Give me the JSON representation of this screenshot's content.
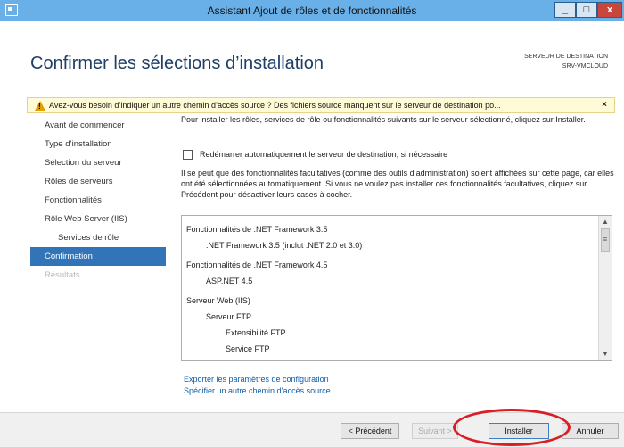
{
  "window": {
    "title": "Assistant Ajout de rôles et de fonctionnalités",
    "minimize": "_",
    "maximize": "□",
    "close": "x"
  },
  "header": {
    "title": "Confirmer les sélections d’installation",
    "destination_label": "SERVEUR DE DESTINATION",
    "destination_server": "SRV-VMCLOUD"
  },
  "warning": {
    "icon_glyph": "!",
    "text": "Avez-vous besoin d’indiquer un autre chemin d’accès source ? Des fichiers source manquent sur le serveur de destination po...",
    "close": "×"
  },
  "sidebar": {
    "items": [
      {
        "label": "Avant de commencer",
        "state": "normal"
      },
      {
        "label": "Type d’installation",
        "state": "normal"
      },
      {
        "label": "Sélection du serveur",
        "state": "normal"
      },
      {
        "label": "Rôles de serveurs",
        "state": "normal"
      },
      {
        "label": "Fonctionnalités",
        "state": "normal"
      },
      {
        "label": "Rôle Web Server (IIS)",
        "state": "normal"
      },
      {
        "label": "Services de rôle",
        "state": "sub"
      },
      {
        "label": "Confirmation",
        "state": "active"
      },
      {
        "label": "Résultats",
        "state": "disabled"
      }
    ]
  },
  "content": {
    "intro": "Pour installer les rôles, services de rôle ou fonctionnalités suivants sur le serveur sélectionné, cliquez sur Installer.",
    "restart_label": "Redémarrer automatiquement le serveur de destination, si nécessaire",
    "restart_checked": false,
    "note": "Il se peut que des fonctionnalités facultatives (comme des outils d’administration) soient affichées sur cette page, car elles ont été sélectionnées automatiquement. Si vous ne voulez pas installer ces fonctionnalités facultatives, cliquez sur Précédent pour désactiver leurs cases à cocher.",
    "list": [
      {
        "label": "Fonctionnalités de .NET Framework 3.5",
        "level": 0
      },
      {
        "label": ".NET Framework 3.5 (inclut .NET 2.0 et 3.0)",
        "level": 1
      },
      {
        "label": "Fonctionnalités de .NET Framework 4.5",
        "level": 0
      },
      {
        "label": "ASP.NET 4.5",
        "level": 1
      },
      {
        "label": "Serveur Web (IIS)",
        "level": 0
      },
      {
        "label": "Serveur FTP",
        "level": 1
      },
      {
        "label": "Extensibilité FTP",
        "level": 2
      },
      {
        "label": "Service FTP",
        "level": 2
      }
    ],
    "links": {
      "export": "Exporter les paramètres de configuration",
      "source": "Spécifier un autre chemin d’accès source"
    }
  },
  "footer": {
    "previous": "< Précédent",
    "next": "Suivant >",
    "install": "Installer",
    "cancel": "Annuler"
  }
}
